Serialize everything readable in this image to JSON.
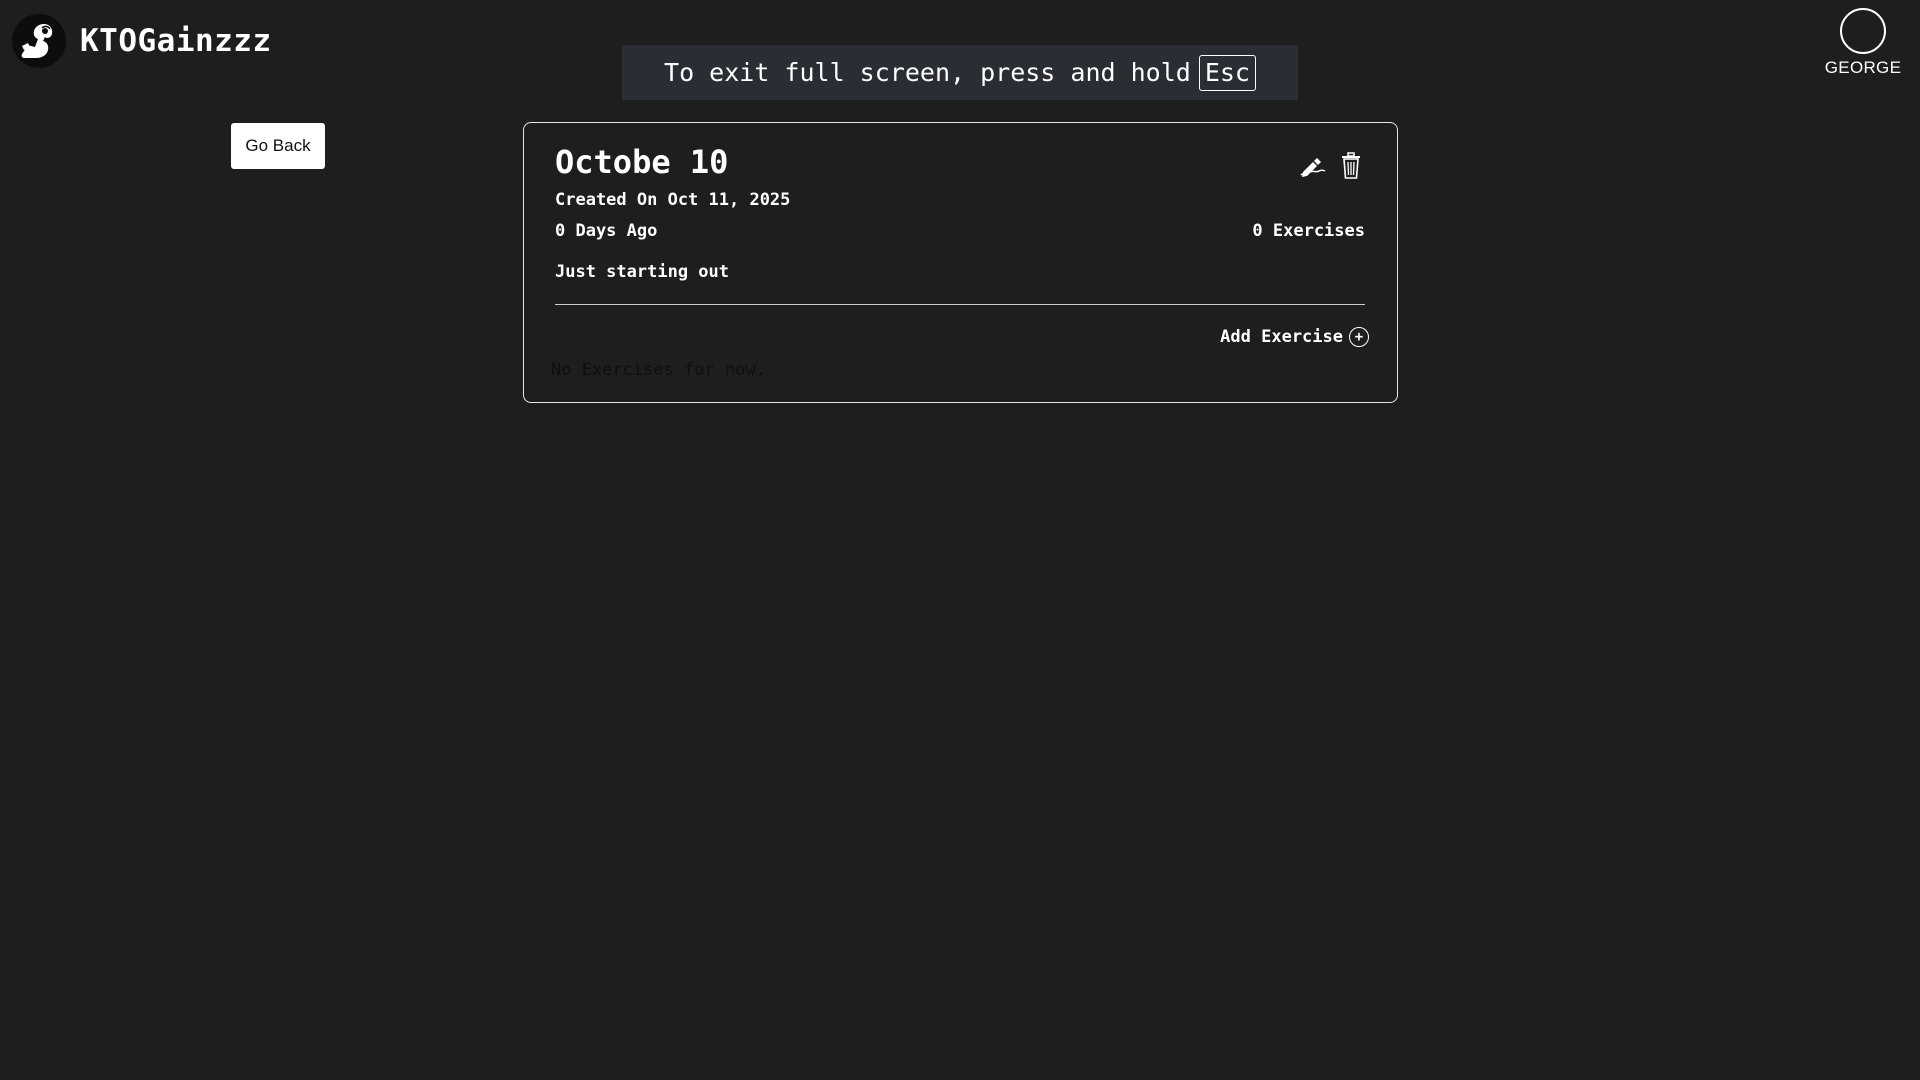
{
  "header": {
    "brand": "KTOGainzzz",
    "logo_icon": "flexing-arm-logo-icon",
    "user_name": "GEORGE"
  },
  "fullscreen_notice": {
    "text": "To exit full screen, press and hold",
    "key": "Esc"
  },
  "nav": {
    "go_back_label": "Go Back"
  },
  "workout": {
    "title": "Octobe 10",
    "created": "Created On Oct 11, 2025",
    "ago": "0 Days Ago",
    "exercise_count": "0 Exercises",
    "description": "Just starting out",
    "add_exercise_label": "Add Exercise",
    "empty_message": "No Exercises for now.",
    "icons": [
      "edit-icon",
      "trash-icon",
      "plus-circle-icon"
    ]
  },
  "colors": {
    "background": "#1e1e1e",
    "text": "#ffffff",
    "notice_background": "#2a2d33"
  }
}
